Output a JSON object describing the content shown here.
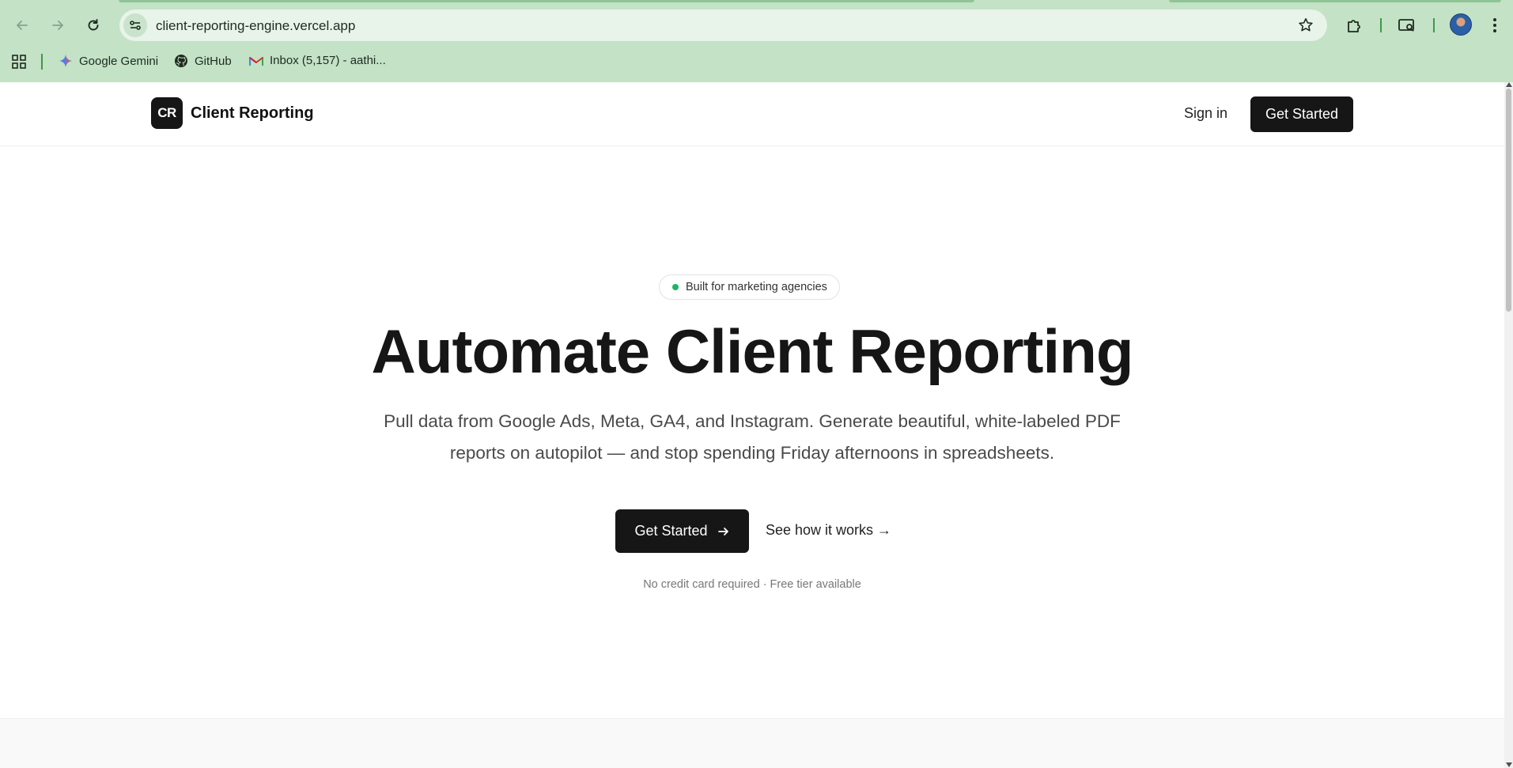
{
  "browser": {
    "url": "client-reporting-engine.vercel.app",
    "bookmarks": [
      {
        "label": "Google Gemini",
        "icon": "gemini-icon"
      },
      {
        "label": "GitHub",
        "icon": "github-icon"
      },
      {
        "label": "Inbox (5,157) - aathi...",
        "icon": "gmail-icon"
      }
    ],
    "colors": {
      "frame": "#c3e2c6",
      "omnibox": "#e8f3e9"
    }
  },
  "header": {
    "logo_text": "CR",
    "brand_name": "Client Reporting",
    "signin_label": "Sign in",
    "cta_label": "Get Started"
  },
  "hero": {
    "badge": "Built for marketing agencies",
    "title": "Automate Client Reporting",
    "subtitle": "Pull data from Google Ads, Meta, GA4, and Instagram. Generate beautiful, white-labeled PDF reports on autopilot — and stop spending Friday afternoons in spreadsheets.",
    "primary_cta": "Get Started",
    "secondary_cta": "See how it works →",
    "fine_print": "No credit card required · Free tier available"
  },
  "colors": {
    "dark": "#161616",
    "badge_dot": "#22b363",
    "muted": "#777777"
  }
}
